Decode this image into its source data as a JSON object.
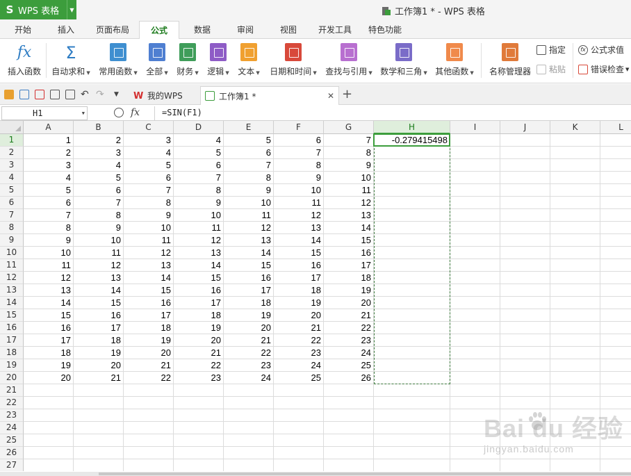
{
  "app": {
    "logo_letter": "S",
    "name": "WPS 表格",
    "window_title": "工作簿1 * - WPS 表格"
  },
  "menu_tabs": [
    "开始",
    "插入",
    "页面布局",
    "公式",
    "数据",
    "审阅",
    "视图",
    "开发工具",
    "特色功能"
  ],
  "active_menu_tab": "公式",
  "ribbon": {
    "insert_function": "插入函数",
    "autosum": "自动求和",
    "common_functions": "常用函数",
    "all": "全部",
    "financial": "财务",
    "logical": "逻辑",
    "text": "文本",
    "datetime": "日期和时间",
    "lookup": "查找与引用",
    "math": "数学和三角",
    "other": "其他函数",
    "name_manager": "名称管理器",
    "assign": "指定",
    "paste": "粘贴",
    "evaluate": "公式求值",
    "error_check": "错误检查"
  },
  "doc_tabs": {
    "my_wps": "我的WPS",
    "workbook": "工作簿1 *"
  },
  "formula_bar": {
    "cell_ref": "H1",
    "fx": "fx",
    "formula": "=SIN(F1)"
  },
  "columns": [
    "A",
    "B",
    "C",
    "D",
    "E",
    "F",
    "G",
    "H",
    "I",
    "J",
    "K",
    "L"
  ],
  "selected_column": "H",
  "selected_row": 1,
  "row_count": 27,
  "cells": [
    [
      "1",
      "2",
      "3",
      "4",
      "5",
      "6",
      "7",
      "-0.279415498"
    ],
    [
      "2",
      "3",
      "4",
      "5",
      "6",
      "7",
      "8"
    ],
    [
      "3",
      "4",
      "5",
      "6",
      "7",
      "8",
      "9"
    ],
    [
      "4",
      "5",
      "6",
      "7",
      "8",
      "9",
      "10"
    ],
    [
      "5",
      "6",
      "7",
      "8",
      "9",
      "10",
      "11"
    ],
    [
      "6",
      "7",
      "8",
      "9",
      "10",
      "11",
      "12"
    ],
    [
      "7",
      "8",
      "9",
      "10",
      "11",
      "12",
      "13"
    ],
    [
      "8",
      "9",
      "10",
      "11",
      "12",
      "13",
      "14"
    ],
    [
      "9",
      "10",
      "11",
      "12",
      "13",
      "14",
      "15"
    ],
    [
      "10",
      "11",
      "12",
      "13",
      "14",
      "15",
      "16"
    ],
    [
      "11",
      "12",
      "13",
      "14",
      "15",
      "16",
      "17"
    ],
    [
      "12",
      "13",
      "14",
      "15",
      "16",
      "17",
      "18"
    ],
    [
      "13",
      "14",
      "15",
      "16",
      "17",
      "18",
      "19"
    ],
    [
      "14",
      "15",
      "16",
      "17",
      "18",
      "19",
      "20"
    ],
    [
      "15",
      "16",
      "17",
      "18",
      "19",
      "20",
      "21"
    ],
    [
      "16",
      "17",
      "18",
      "19",
      "20",
      "21",
      "22"
    ],
    [
      "17",
      "18",
      "19",
      "20",
      "21",
      "22",
      "23"
    ],
    [
      "18",
      "19",
      "20",
      "21",
      "22",
      "23",
      "24"
    ],
    [
      "19",
      "20",
      "21",
      "22",
      "23",
      "24",
      "25"
    ],
    [
      "20",
      "21",
      "22",
      "23",
      "24",
      "25",
      "26"
    ]
  ],
  "watermark": {
    "main": "Bai  du 经验",
    "sub": "jingyan.baidu.com"
  },
  "colors": {
    "accent": "#3c9d3c",
    "fx_blue": "#2f7dc4"
  }
}
